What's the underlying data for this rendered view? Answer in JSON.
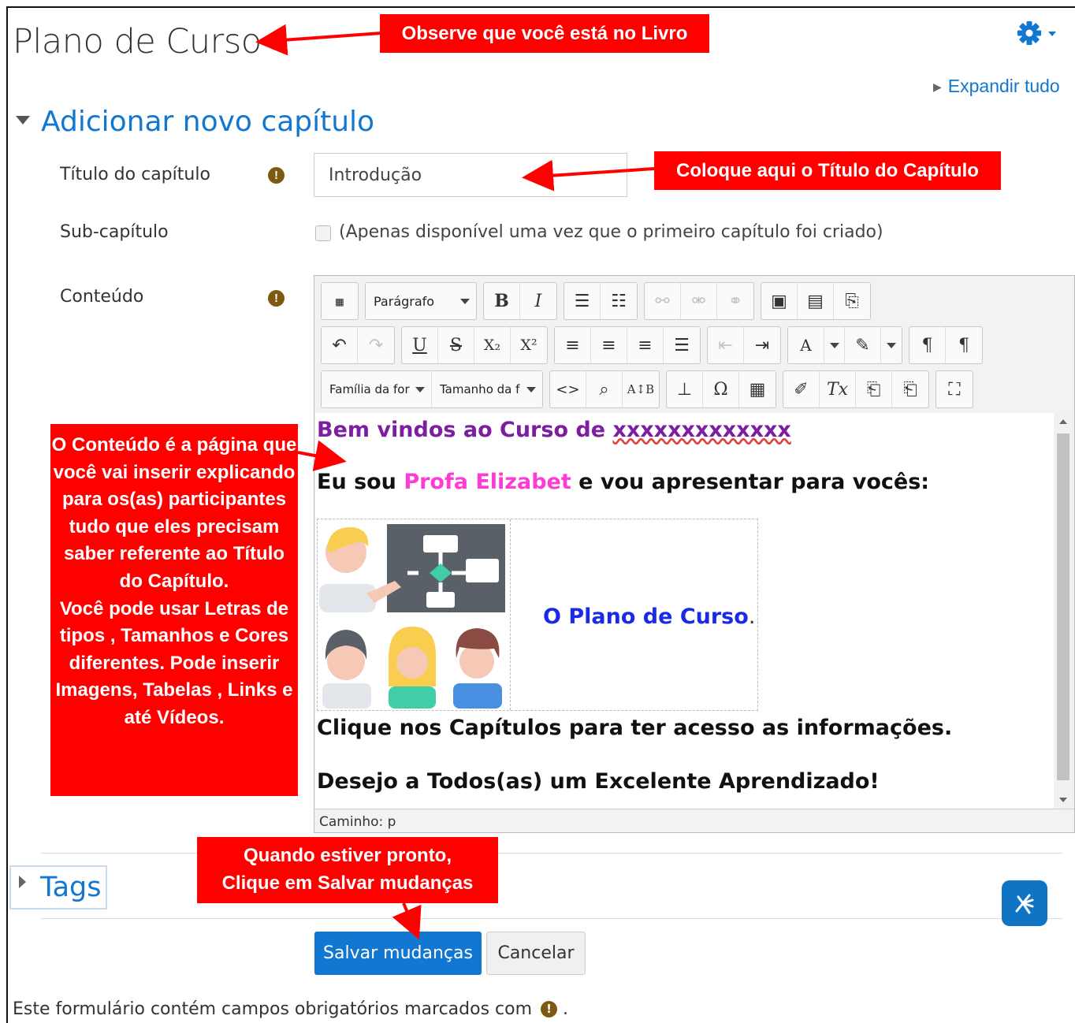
{
  "page": {
    "title": "Plano de Curso",
    "expand_all": "Expandir tudo",
    "section_title": "Adicionar novo capítulo"
  },
  "form": {
    "chapter_title_label": "Título do capítulo",
    "chapter_title_value": "Introdução",
    "subchapter_label": "Sub-capítulo",
    "subchapter_checked": false,
    "subchapter_note": "(Apenas disponível uma vez que o primeiro capítulo foi criado)",
    "content_label": "Conteúdo",
    "required_icon": "exclamation-circle-icon"
  },
  "editor": {
    "format_select": "Parágrafo",
    "font_family_select": "Família da for",
    "font_size_select": "Tamanho da f",
    "status_path": "Caminho: p",
    "content": {
      "line1_prefix": "Bem vindos ao Curso de ",
      "line1_underlined": "xxxxxxxxxxxxx",
      "line2_prefix": "Eu sou ",
      "line2_name": "Profa Elizabet",
      "line2_suffix": " e vou apresentar para vocês:",
      "table_text": "O Plano de Curso",
      "table_text_dot": ".",
      "line4": "Clique nos Capítulos para ter acesso as informações.",
      "line5": "Desejo a Todos(as) um Excelente Aprendizado!"
    },
    "colors": {
      "line1": "#7b1ea0",
      "name": "#ff3bd6",
      "table_text": "#1a2be8"
    }
  },
  "tags": {
    "label": "Tags"
  },
  "actions": {
    "save": "Salvar mudanças",
    "cancel": "Cancelar"
  },
  "footer": {
    "note_prefix": "Este formulário contém campos obrigatórios marcados com",
    "note_suffix": "."
  },
  "annotations": {
    "c1": "Observe que você está no Livro",
    "c2": "Coloque aqui o Título do Capítulo",
    "c3": "O Conteúdo é a página que você vai inserir explicando para os(as) participantes  tudo que eles precisam saber referente ao Título do Capítulo.\nVocê pode usar Letras de tipos , Tamanhos e Cores diferentes. Pode inserir  Imagens, Tabelas , Links e até Vídeos.",
    "c4": "Quando estiver pronto,\nClique em Salvar mudanças",
    "color": "#ff0000"
  },
  "theme": {
    "accent": "#1177d1",
    "required": "#7d5a12"
  }
}
